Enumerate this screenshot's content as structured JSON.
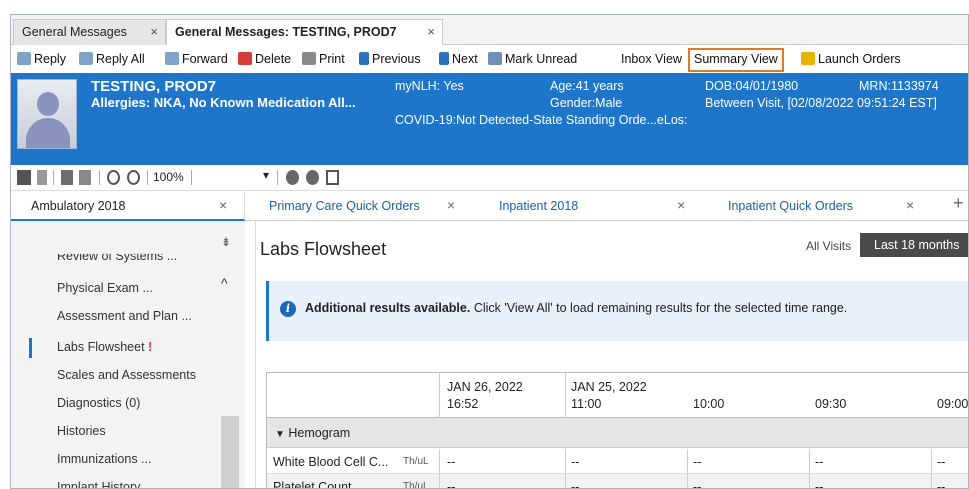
{
  "doc_tabs": [
    {
      "label": "General Messages",
      "close": "×"
    },
    {
      "label": "General Messages: TESTING, PROD7",
      "close": "×"
    }
  ],
  "toolbar": {
    "reply": "Reply",
    "reply_all": "Reply All",
    "forward": "Forward",
    "delete": "Delete",
    "print": "Print",
    "previous": "Previous",
    "next": "Next",
    "mark_unread": "Mark Unread",
    "inbox_view": "Inbox View",
    "summary_view": "Summary View",
    "launch_orders": "Launch Orders"
  },
  "banner": {
    "name": "TESTING, PROD7",
    "allergies": "Allergies: NKA, No Known Medication All...",
    "mynlh": "myNLH: Yes",
    "age": "Age:41 years",
    "gender": "Gender:Male",
    "covid": "COVID-19:Not Detected-State Standing Orde...eLos:",
    "dob": "DOB:04/01/1980",
    "mrn": "MRN:1133974",
    "visit": "Between Visit, [02/08/2022 09:51:24 EST]"
  },
  "zoom": "100%",
  "component_tabs": [
    {
      "label": "Ambulatory 2018",
      "close": "×"
    },
    {
      "label": "Primary Care Quick Orders",
      "close": "×"
    },
    {
      "label": "Inpatient 2018",
      "close": "×"
    },
    {
      "label": "Inpatient Quick Orders",
      "close": "×"
    }
  ],
  "nav": {
    "items": [
      "Review of Systems ...",
      "Physical Exam ...",
      "Assessment and Plan ...",
      "Labs Flowsheet",
      "Scales and Assessments",
      "Diagnostics (0)",
      "Histories",
      "Immunizations ...",
      "Implant History ..."
    ],
    "selected_index": 3,
    "pin": "⇟",
    "up": "^"
  },
  "main": {
    "title": "Labs Flowsheet",
    "all_visits": "All Visits",
    "last_18": "Last 18 months",
    "info_bold": "Additional results available.",
    "info_text": "Click 'View All' to load remaining results for the selected time range.",
    "columns": [
      {
        "date": "JAN 26, 2022",
        "time": "16:52"
      },
      {
        "date": "JAN 25, 2022",
        "time": "11:00"
      },
      {
        "date": "",
        "time": "10:00"
      },
      {
        "date": "",
        "time": "09:30"
      },
      {
        "date": "",
        "time": "09:00"
      }
    ],
    "group": "Hemogram",
    "rows": [
      {
        "name": "White Blood Cell C...",
        "unit": "Th/uL",
        "values": [
          "--",
          "--",
          "--",
          "--",
          "--"
        ]
      },
      {
        "name": "Platelet Count",
        "unit": "Th/uL",
        "values": [
          "--",
          "--",
          "--",
          "--",
          "--"
        ]
      }
    ]
  },
  "colors": {
    "banner": "#1d76c9",
    "summary_outline": "#e07b22",
    "last18_bg": "#4a4a4a"
  }
}
